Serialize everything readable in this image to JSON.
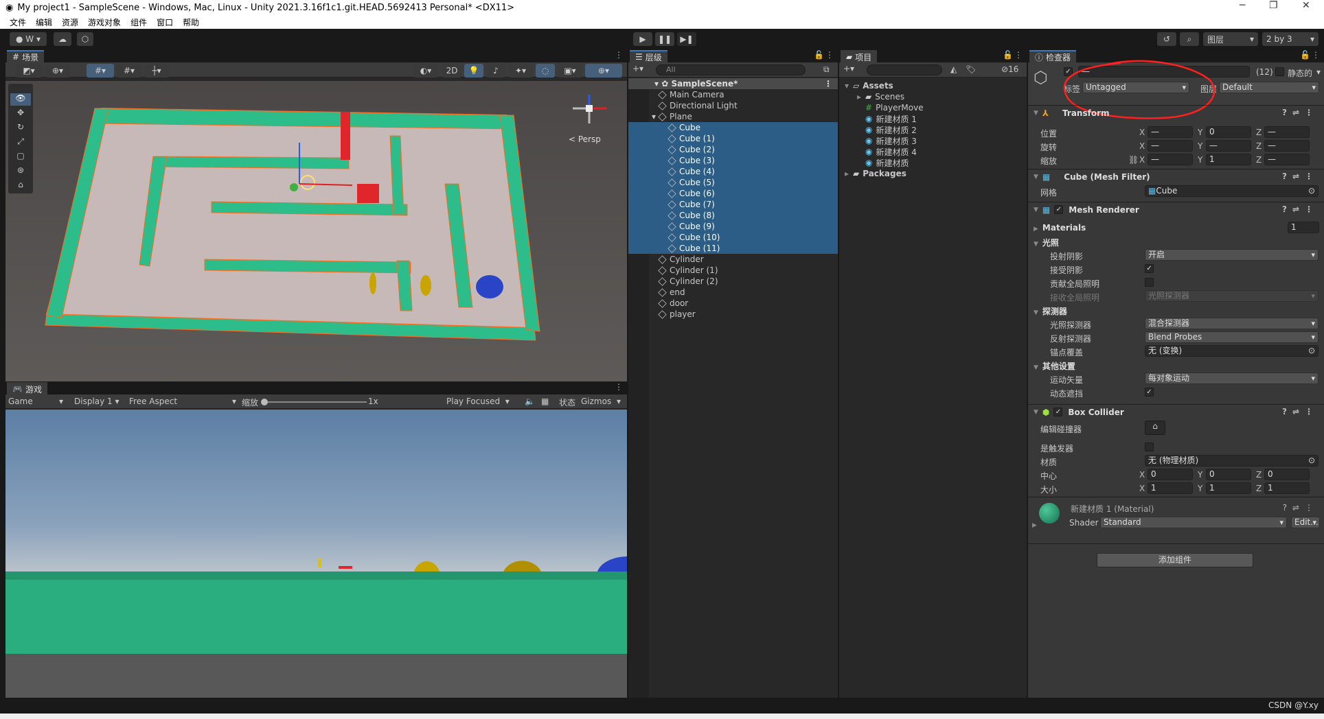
{
  "window": {
    "title": "My project1 - SampleScene - Windows, Mac, Linux - Unity 2021.3.16f1c1.git.HEAD.5692413 Personal* <DX11>",
    "minimize": "─",
    "maximize": "❐",
    "close": "✕"
  },
  "menu": [
    "文件",
    "编辑",
    "资源",
    "游戏对象",
    "组件",
    "窗口",
    "帮助"
  ],
  "toolbar": {
    "account": "W",
    "layers": "图层",
    "layout": "2 by 3"
  },
  "scene": {
    "tab": "场景",
    "mode_2d": "2D",
    "persp": "< Persp"
  },
  "game": {
    "tab": "游戏",
    "view": "Game",
    "display": "Display 1",
    "aspect": "Free Aspect",
    "scale_label": "缩放",
    "scale_value": "1x",
    "play_mode": "Play Focused",
    "stats": "状态",
    "gizmos": "Gizmos",
    "scale_fraction": 0
  },
  "hierarchy": {
    "tab": "层级",
    "search_placeholder": "All",
    "scene": "SampleScene*",
    "items": [
      {
        "name": "Main Camera",
        "depth": 1,
        "selected": false
      },
      {
        "name": "Directional Light",
        "depth": 1,
        "selected": false
      },
      {
        "name": "Plane",
        "depth": 1,
        "selected": false,
        "expanded": true
      },
      {
        "name": "Cube",
        "depth": 2,
        "selected": true
      },
      {
        "name": "Cube (1)",
        "depth": 2,
        "selected": true
      },
      {
        "name": "Cube (2)",
        "depth": 2,
        "selected": true
      },
      {
        "name": "Cube (3)",
        "depth": 2,
        "selected": true
      },
      {
        "name": "Cube (4)",
        "depth": 2,
        "selected": true
      },
      {
        "name": "Cube (5)",
        "depth": 2,
        "selected": true
      },
      {
        "name": "Cube (6)",
        "depth": 2,
        "selected": true
      },
      {
        "name": "Cube (7)",
        "depth": 2,
        "selected": true
      },
      {
        "name": "Cube (8)",
        "depth": 2,
        "selected": true
      },
      {
        "name": "Cube (9)",
        "depth": 2,
        "selected": true
      },
      {
        "name": "Cube (10)",
        "depth": 2,
        "selected": true
      },
      {
        "name": "Cube (11)",
        "depth": 2,
        "selected": true
      },
      {
        "name": "Cylinder",
        "depth": 1,
        "selected": false
      },
      {
        "name": "Cylinder (1)",
        "depth": 1,
        "selected": false
      },
      {
        "name": "Cylinder (2)",
        "depth": 1,
        "selected": false
      },
      {
        "name": "end",
        "depth": 1,
        "selected": false
      },
      {
        "name": "door",
        "depth": 1,
        "selected": false
      },
      {
        "name": "player",
        "depth": 1,
        "selected": false
      }
    ]
  },
  "project": {
    "tab": "项目",
    "hidden_count": "16",
    "items": [
      {
        "name": "Assets",
        "type": "folder-open",
        "depth": 0
      },
      {
        "name": "Scenes",
        "type": "folder",
        "depth": 1
      },
      {
        "name": "PlayerMove",
        "type": "script",
        "depth": 1
      },
      {
        "name": "新建材质 1",
        "type": "material",
        "depth": 1
      },
      {
        "name": "新建材质 2",
        "type": "material",
        "depth": 1
      },
      {
        "name": "新建材质 3",
        "type": "material",
        "depth": 1
      },
      {
        "name": "新建材质 4",
        "type": "material",
        "depth": 1
      },
      {
        "name": "新建材质",
        "type": "material",
        "depth": 1
      },
      {
        "name": "Packages",
        "type": "folder",
        "depth": 0
      }
    ]
  },
  "inspector": {
    "tab": "检查器",
    "name_value": "—",
    "count": "(12)",
    "static_label": "静态的",
    "tag_label": "标签",
    "tag": "Untagged",
    "layer_label": "图层",
    "layer": "Default",
    "transform": {
      "title": "Transform",
      "position": {
        "label": "位置",
        "x": "—",
        "y": "0",
        "z": "—"
      },
      "rotation": {
        "label": "旋转",
        "x": "—",
        "y": "—",
        "z": "—"
      },
      "scale": {
        "label": "缩放",
        "x": "—",
        "y": "1",
        "z": "—"
      }
    },
    "mesh_filter": {
      "title": "Cube (Mesh Filter)",
      "mesh_label": "网格",
      "mesh": "Cube"
    },
    "mesh_renderer": {
      "title": "Mesh Renderer",
      "materials_label": "Materials",
      "materials_count": "1",
      "lighting": "光照",
      "cast_shadows_label": "投射阴影",
      "cast_shadows": "开启",
      "receive_shadows_label": "接受阴影",
      "contribute_gi_label": "贡献全局照明",
      "receive_gi_label": "接收全局照明",
      "receive_gi": "光照探测器",
      "probes": "探测器",
      "light_probes_label": "光照探测器",
      "light_probes": "混合探测器",
      "reflection_probes_label": "反射探测器",
      "reflection_probes": "Blend Probes",
      "anchor_label": "锚点覆盖",
      "anchor": "无 (变换)",
      "other": "其他设置",
      "motion_label": "运动矢量",
      "motion": "每对象运动",
      "dynamic_occ_label": "动态遮挡"
    },
    "box_collider": {
      "title": "Box Collider",
      "edit_label": "编辑碰撞器",
      "trigger_label": "是触发器",
      "material_label": "材质",
      "material": "无 (物理材质)",
      "center_label": "中心",
      "center": {
        "x": "0",
        "y": "0",
        "z": "0"
      },
      "size_label": "大小",
      "size": {
        "x": "1",
        "y": "1",
        "z": "1"
      }
    },
    "material": {
      "title": "新建材质 1 (Material)",
      "shader_label": "Shader",
      "shader": "Standard",
      "edit": "Edit..."
    },
    "add_component": "添加组件"
  },
  "axes": {
    "x": "X",
    "y": "Y",
    "z": "Z"
  },
  "watermark": "CSDN @Y.xy",
  "colors": {
    "selection": "#2c5d87",
    "wall": "#2dbd8a",
    "annotation": "#ff2020"
  }
}
